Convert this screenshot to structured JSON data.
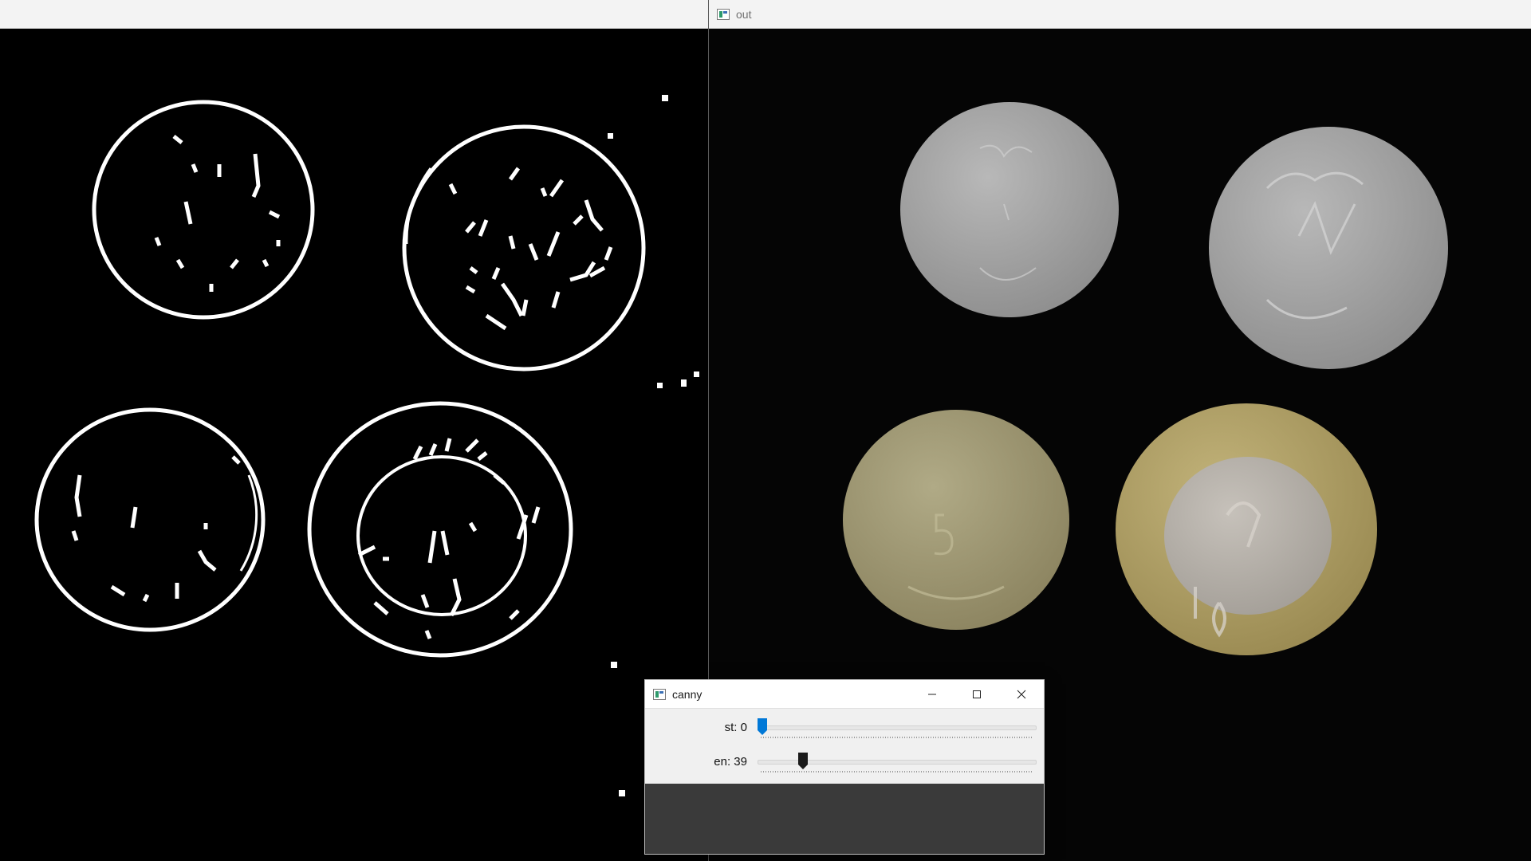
{
  "out_window": {
    "title": "out",
    "icon": "opencv-window-icon"
  },
  "edge_window": {
    "icon": "opencv-window-icon"
  },
  "canny_window": {
    "title": "canny",
    "icon": "opencv-window-icon",
    "controls": {
      "minimize": "minimize-icon",
      "maximize": "maximize-icon",
      "close": "close-icon"
    },
    "trackbars": [
      {
        "label": "st: 0",
        "value": 0,
        "max": 255,
        "thumb_color": "#0078d7"
      },
      {
        "label": "en: 39",
        "value": 39,
        "max": 255,
        "thumb_color": "#1a1a1a"
      }
    ]
  },
  "colors": {
    "accent": "#0078d7",
    "titlebar": "#f3f3f3",
    "image_background": "#000000",
    "edge_stroke": "#ffffff",
    "silver_coin": "#a2a2a2",
    "brass_coin": "#a39a6e",
    "bimetal_outer": "#b3a36a",
    "bimetal_inner": "#b8b3ad"
  }
}
